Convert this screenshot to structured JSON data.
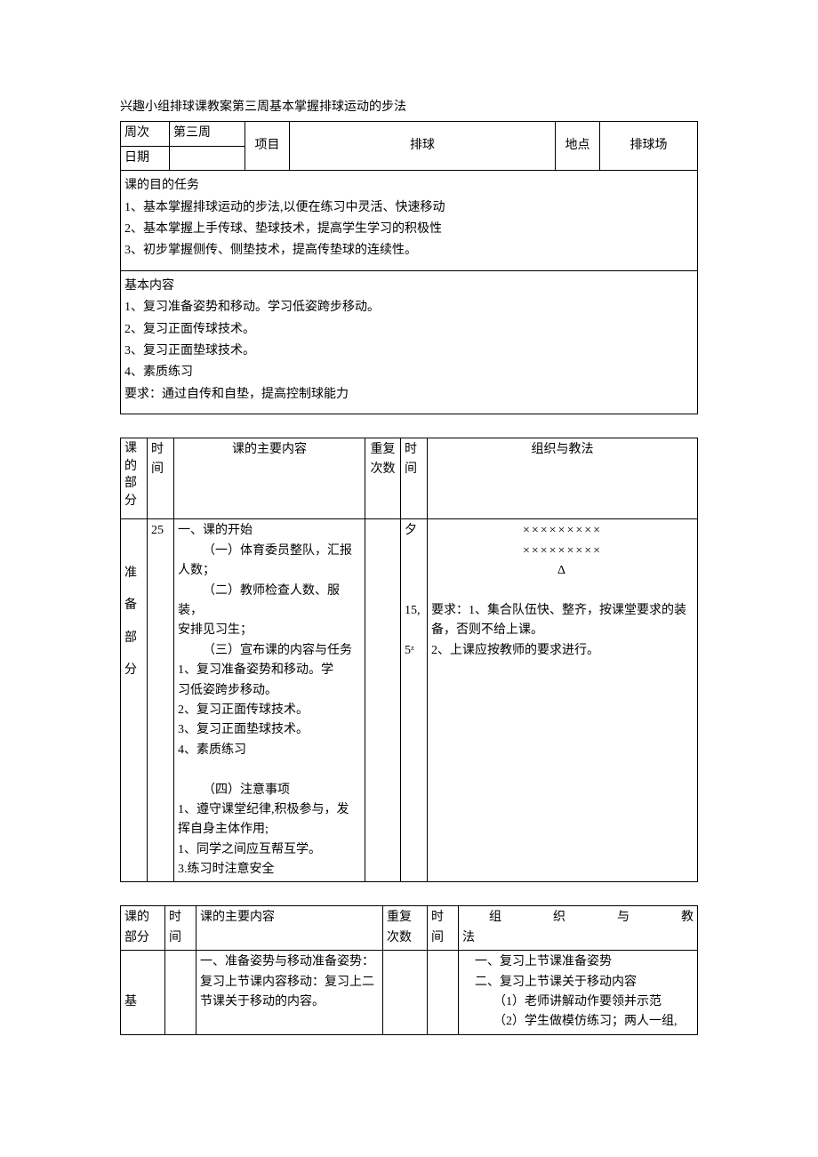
{
  "title": "兴趣小组排球课教案第三周基本掌握排球运动的步法",
  "header": {
    "week_label": "周次",
    "week_value": "第三周",
    "date_label": "日期",
    "subject_label": "项目",
    "subject_value": "排球",
    "location_label": "地点",
    "location_value": "排球场"
  },
  "objectives": {
    "heading": "课的目的任务",
    "items": [
      "1、基本掌握排球运动的步法,以便在练习中灵活、快速移动",
      "2、基本掌握上手传球、垫球技术，提高学生学习的积极性",
      "3、初步掌握侧传、侧垫技术，提高传垫球的连续性。"
    ]
  },
  "content": {
    "heading": "基本内容",
    "items": [
      "1、复习准备姿势和移动。学习低姿跨步移动。",
      "2、复习正面传球技术。",
      "3、复习正面垫球技术。",
      "4、素质练习"
    ],
    "requirement": "要求：通过自传和自垫，提高控制球能力"
  },
  "table2": {
    "headers": {
      "col1": "课的部分",
      "col2": "时间",
      "col3": "课的主要内容",
      "col4": "重复次数",
      "col5": "时间",
      "col6": "组织与教法"
    },
    "row1": {
      "part": "准\n\n备\n\n部\n\n分",
      "time1": "25",
      "main": {
        "l1": "一、课的开始",
        "l2": "（一）体育委员整队，汇报",
        "l3": "人数；",
        "l4": "（二）教师检查人数、服装，",
        "l5": "安排见习生；",
        "l6": "（三）宣布课的内容与任务",
        "l7": "1、复习准备姿势和移动。学",
        "l8": "习低姿跨步移动。",
        "l9": "2、复习正面传球技术。",
        "l10": "3、复习正面垫球技术。",
        "l11": "4、素质练习",
        "l12": "（四）注意事项",
        "l13": "1、遵守课堂纪律,积极参与，发",
        "l14": "挥自身主体作用;",
        "l15": "1、同学之间应互帮互学。",
        "l16": "3.练习时注意安全"
      },
      "time2a": "夕",
      "time2b": "15,",
      "time2c": "5ᶻ",
      "org": {
        "f1": "×××××××××",
        "f2": "×××××××××",
        "f3": "Δ",
        "r1": "要求：1、集合队伍快、整齐，按课堂要求的装备，否则不给上课。",
        "r2": "2、上课应按教师的要求进行。"
      }
    }
  },
  "table3": {
    "headers": {
      "col1": "课的部分",
      "col2": "时间",
      "col3": "课的主要内容",
      "col4": "重复次数",
      "col5": "时间",
      "col6_line1": "组　　　织　　　与　　　教",
      "col6_line2": "法"
    },
    "row1": {
      "part": "基",
      "main": "一、准备姿势与移动准备姿势：复习上节课内容移动：复习上二节课关于移动的内容。",
      "org": {
        "l1": "一、复习上节课准备姿势",
        "l2": "二、复习上节课关于移动内容",
        "l3": "（1）老师讲解动作要领并示范",
        "l4": "（2）学生做模仿练习；两人一组,"
      }
    }
  }
}
